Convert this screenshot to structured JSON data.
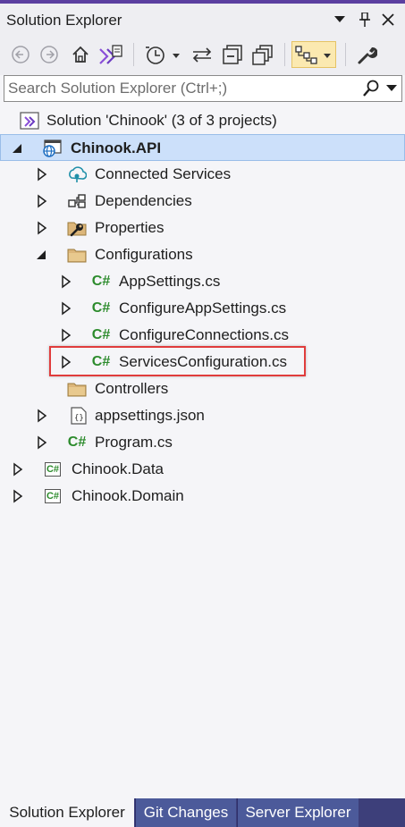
{
  "window": {
    "title": "Solution Explorer",
    "controls": [
      "dropdown-icon",
      "pin-icon",
      "close-icon"
    ]
  },
  "toolbar": {
    "buttons": [
      "back-icon",
      "forward-icon",
      "home-icon",
      "vs-switch-views-icon",
      "pending-changes-filter-icon",
      "sync-icon",
      "collapse-all-icon",
      "show-all-files-icon",
      "preview-selected-items-icon",
      "properties-icon"
    ]
  },
  "search": {
    "placeholder": "Search Solution Explorer (Ctrl+;)",
    "value": ""
  },
  "tree": {
    "solution": "Solution 'Chinook' (3 of 3 projects)",
    "project": "Chinook.API",
    "items": {
      "connected_services": "Connected Services",
      "dependencies": "Dependencies",
      "properties": "Properties",
      "configurations": "Configurations",
      "appsettings_cs": "AppSettings.cs",
      "configure_appsettings_cs": "ConfigureAppSettings.cs",
      "configure_connections_cs": "ConfigureConnections.cs",
      "services_configuration_cs": "ServicesConfiguration.cs",
      "controllers": "Controllers",
      "appsettings_json": "appsettings.json",
      "program_cs": "Program.cs",
      "chinook_data": "Chinook.Data",
      "chinook_domain": "Chinook.Domain"
    },
    "csharp_glyph": "C#"
  },
  "tabs": [
    "Solution Explorer",
    "Git Changes",
    "Server Explorer"
  ],
  "colors": {
    "accent": "#5b3fa0",
    "selection": "#cce0fa",
    "highlight_box": "#e03c3c",
    "tabbar": "#3d3f7a",
    "csharp_green": "#2c8b2c"
  }
}
